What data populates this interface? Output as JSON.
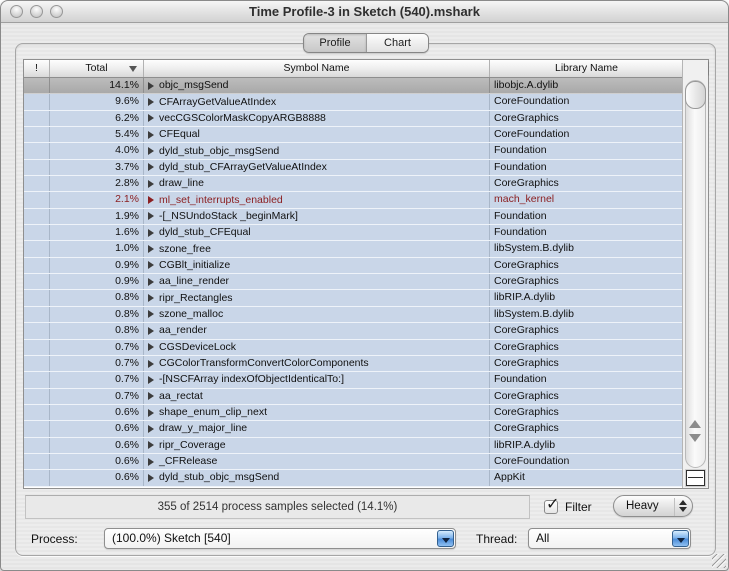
{
  "window": {
    "title": "Time Profile-3 in Sketch (540).mshark"
  },
  "tabs": [
    {
      "label": "Profile",
      "selected": true
    },
    {
      "label": "Chart",
      "selected": false
    }
  ],
  "table": {
    "columns": {
      "alert": "!",
      "total": "Total",
      "symbol": "Symbol Name",
      "library": "Library Name"
    },
    "sort": {
      "column": "Total",
      "direction": "descending"
    },
    "rows": [
      {
        "total": "14.1%",
        "symbol": "objc_msgSend",
        "library": "libobjc.A.dylib",
        "selected": true
      },
      {
        "total": "9.6%",
        "symbol": "CFArrayGetValueAtIndex",
        "library": "CoreFoundation"
      },
      {
        "total": "6.2%",
        "symbol": "vecCGSColorMaskCopyARGB8888",
        "library": "CoreGraphics"
      },
      {
        "total": "5.4%",
        "symbol": "CFEqual",
        "library": "CoreFoundation"
      },
      {
        "total": "4.0%",
        "symbol": "dyld_stub_objc_msgSend",
        "library": "Foundation"
      },
      {
        "total": "3.7%",
        "symbol": "dyld_stub_CFArrayGetValueAtIndex",
        "library": "Foundation"
      },
      {
        "total": "2.8%",
        "symbol": "draw_line",
        "library": "CoreGraphics"
      },
      {
        "total": "2.1%",
        "symbol": "ml_set_interrupts_enabled",
        "library": "mach_kernel",
        "kernel": true
      },
      {
        "total": "1.9%",
        "symbol": "-[_NSUndoStack _beginMark]",
        "library": "Foundation"
      },
      {
        "total": "1.6%",
        "symbol": "dyld_stub_CFEqual",
        "library": "Foundation"
      },
      {
        "total": "1.0%",
        "symbol": "szone_free",
        "library": "libSystem.B.dylib"
      },
      {
        "total": "0.9%",
        "symbol": "CGBlt_initialize",
        "library": "CoreGraphics"
      },
      {
        "total": "0.9%",
        "symbol": "aa_line_render",
        "library": "CoreGraphics"
      },
      {
        "total": "0.8%",
        "symbol": "ripr_Rectangles",
        "library": "libRIP.A.dylib"
      },
      {
        "total": "0.8%",
        "symbol": "szone_malloc",
        "library": "libSystem.B.dylib"
      },
      {
        "total": "0.8%",
        "symbol": "aa_render",
        "library": "CoreGraphics"
      },
      {
        "total": "0.7%",
        "symbol": "CGSDeviceLock",
        "library": "CoreGraphics"
      },
      {
        "total": "0.7%",
        "symbol": "CGColorTransformConvertColorComponents",
        "library": "CoreGraphics"
      },
      {
        "total": "0.7%",
        "symbol": "-[NSCFArray indexOfObjectIdenticalTo:]",
        "library": "Foundation"
      },
      {
        "total": "0.7%",
        "symbol": "aa_rectat",
        "library": "CoreGraphics"
      },
      {
        "total": "0.6%",
        "symbol": "shape_enum_clip_next",
        "library": "CoreGraphics"
      },
      {
        "total": "0.6%",
        "symbol": "draw_y_major_line",
        "library": "CoreGraphics"
      },
      {
        "total": "0.6%",
        "symbol": "ripr_Coverage",
        "library": "libRIP.A.dylib"
      },
      {
        "total": "0.6%",
        "symbol": "_CFRelease",
        "library": "CoreFoundation"
      },
      {
        "total": "0.6%",
        "symbol": "dyld_stub_objc_msgSend",
        "library": "AppKit"
      }
    ]
  },
  "status": {
    "text": "355 of 2514 process samples selected (14.1%)"
  },
  "filter": {
    "label": "Filter",
    "checked": true,
    "checkmark": "✓"
  },
  "view_mode": {
    "value": "Heavy"
  },
  "process": {
    "label": "Process:",
    "value": "(100.0%) Sketch [540]"
  },
  "thread": {
    "label": "Thread:",
    "value": "All"
  },
  "colors": {
    "row_blue": "#c9d6e8",
    "selected_row_gray": "#b2b2b2",
    "kernel_text_red": "#8b2022",
    "popup_accent_blue": "#4c8cd8"
  }
}
